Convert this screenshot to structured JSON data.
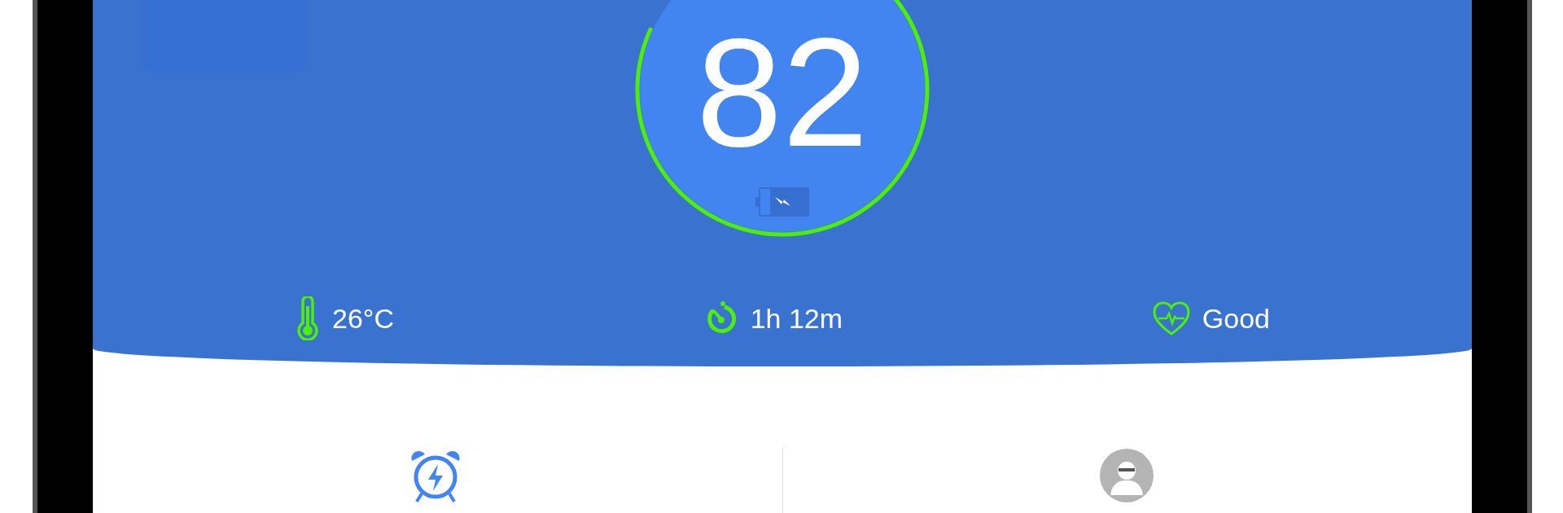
{
  "gauge": {
    "value": "82"
  },
  "stats": [
    {
      "kind": "temperature",
      "value": "26°C"
    },
    {
      "kind": "time",
      "value": "1h 12m"
    },
    {
      "kind": "health",
      "value": "Good"
    }
  ],
  "tiles": [
    {
      "kind": "alarm"
    },
    {
      "kind": "avatar"
    }
  ]
}
